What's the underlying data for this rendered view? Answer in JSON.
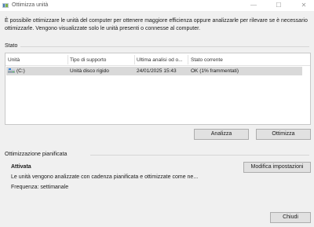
{
  "window": {
    "title": "Ottimizza unità",
    "minimize_glyph": "—",
    "maximize_glyph": "☐",
    "close_glyph": "✕"
  },
  "description": "È possibile ottimizzare le unità del computer per ottenere maggiore efficienza oppure analizzarle per rilevare se è necessario ottimizzarle. Vengono visualizzate solo le unità presenti o connesse al computer.",
  "status_section": {
    "label": "Stato",
    "columns": [
      "Unità",
      "Tipo di supporto",
      "Ultima analisi od o...",
      "Stato corrente"
    ],
    "rows": [
      {
        "drive": "(C:)",
        "media_type": "Unità disco rigido",
        "last_run": "24/01/2025 15:43",
        "status": "OK (1% frammentati)",
        "icon": "hard-drive-icon"
      }
    ],
    "analyze_label": "Analizza",
    "optimize_label": "Ottimizza"
  },
  "scheduled": {
    "label": "Ottimizzazione pianificata",
    "state": "Attivata",
    "detail": "Le unità vengono analizzate con cadenza pianificata e ottimizzate come ne...",
    "frequency": "Frequenza: settimanale",
    "change_settings_label": "Modifica impostazioni"
  },
  "footer": {
    "close_label": "Chiudi"
  },
  "colors": {
    "accent": "#0078d4",
    "selected_row": "#d9d9d9",
    "button_face": "#e1e1e1"
  }
}
